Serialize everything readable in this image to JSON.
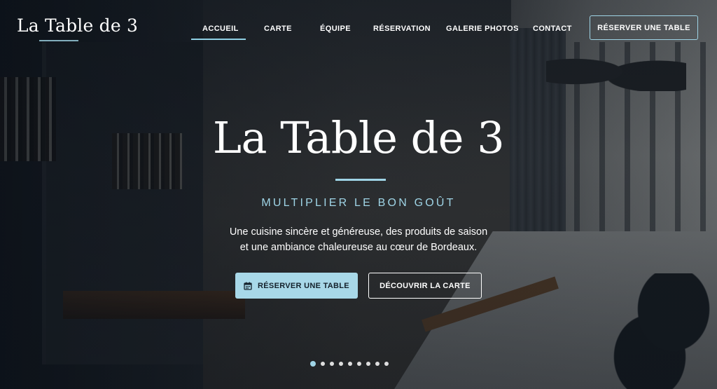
{
  "header": {
    "logo": "La Table de 3",
    "nav": [
      {
        "label": "ACCUEIL",
        "active": true
      },
      {
        "label": "CARTE",
        "active": false
      },
      {
        "label": "ÉQUIPE",
        "active": false
      },
      {
        "label": "RÉSERVATION",
        "active": false
      },
      {
        "label": "GALERIE PHOTOS",
        "active": false
      },
      {
        "label": "CONTACT",
        "active": false
      }
    ],
    "cta_label": "RÉSERVER UNE TABLE"
  },
  "hero": {
    "title": "La Table de 3",
    "subtitle": "MULTIPLIER LE BON GOÛT",
    "description_line1": "Une cuisine sincère et généreuse, des produits de saison",
    "description_line2": "et une ambiance chaleureuse au cœur de Bordeaux.",
    "primary_button": {
      "label": "RÉSERVER UNE TABLE",
      "icon": "calendar-icon"
    },
    "secondary_button": {
      "label": "DÉCOUVRIR LA CARTE"
    }
  },
  "carousel": {
    "slide_count": 9,
    "active_index": 0
  },
  "colors": {
    "accent": "#9fd4e6",
    "primary_button_bg": "#a8d8e8",
    "text": "#ffffff"
  }
}
